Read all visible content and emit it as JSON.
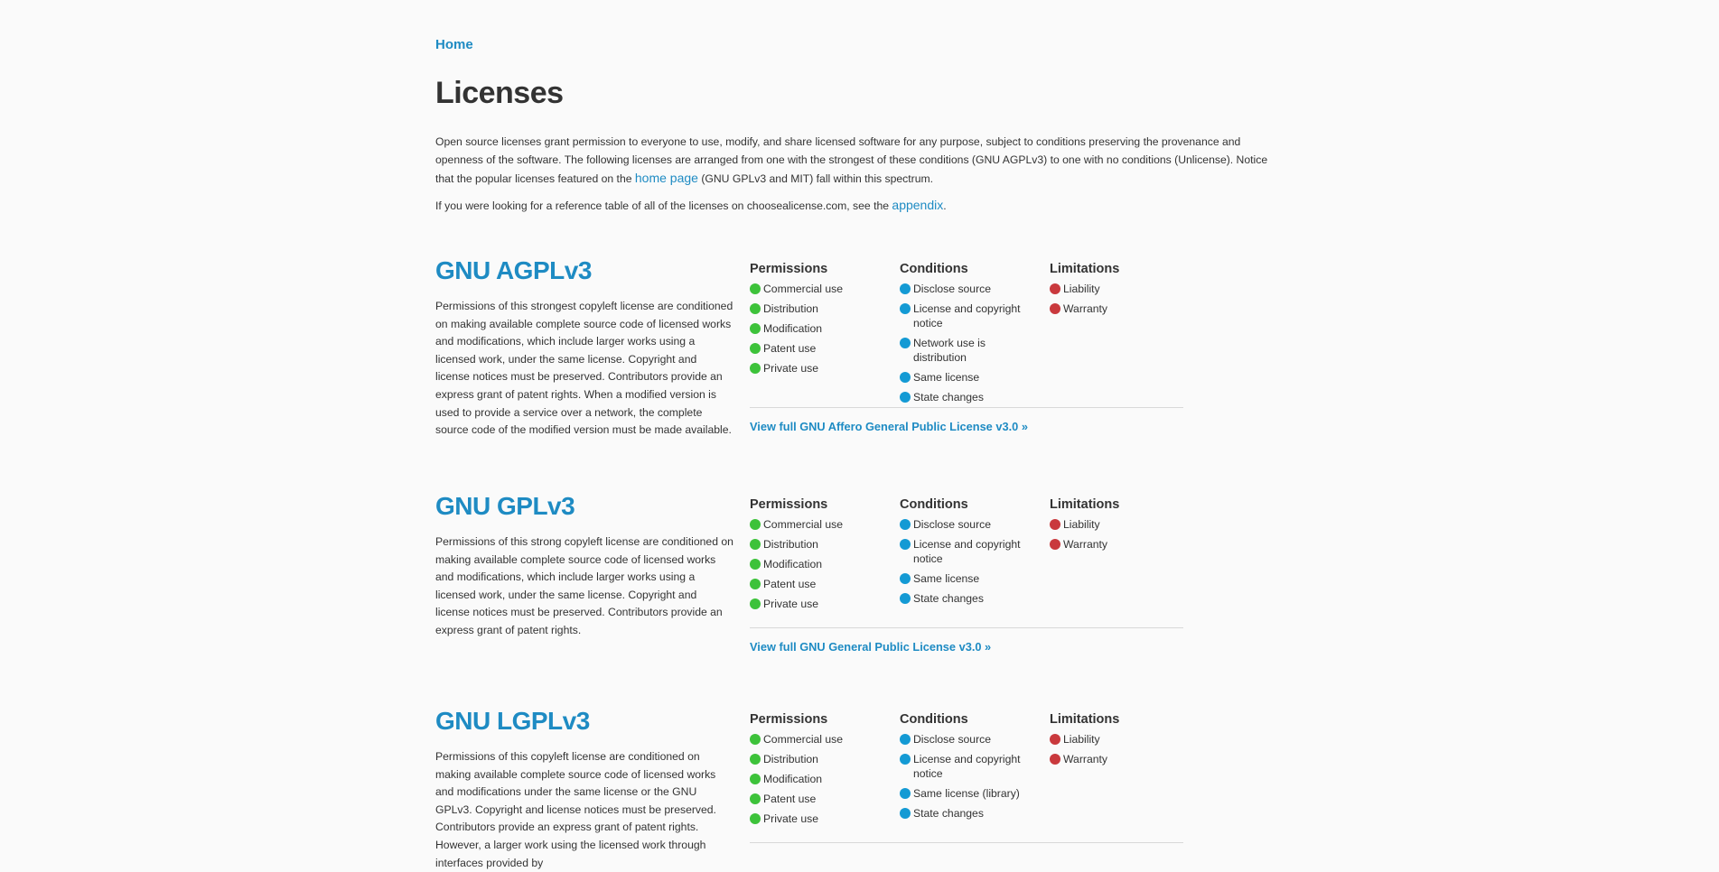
{
  "colors": {
    "accent": "#1e8bc3",
    "permission": "#3dc23a",
    "condition": "#149ad4",
    "limitation": "#c9393d"
  },
  "breadcrumb": {
    "home": "Home"
  },
  "title": "Licenses",
  "intro": {
    "text_1": "Open source licenses grant permission to everyone to use, modify, and share licensed software for any purpose, subject to conditions preserving the provenance and openness of the software. The following licenses are arranged from one with the strongest of these conditions (GNU AGPLv3) to one with no conditions (Unlicense). Notice that the popular licenses featured on the ",
    "link": "home page",
    "text_2": " (GNU GPLv3 and MIT) fall within this spectrum."
  },
  "reference": {
    "text": "If you were looking for a reference table of all of the licenses on choosealicense.com, see the ",
    "link": "appendix",
    "end": "."
  },
  "column_titles": {
    "permissions": "Permissions",
    "conditions": "Conditions",
    "limitations": "Limitations"
  },
  "licenses": [
    {
      "name": "GNU AGPLv3",
      "description": "Permissions of this strongest copyleft license are conditioned on making available complete source code of licensed works and modifications, which include larger works using a licensed work, under the same license. Copyright and license notices must be preserved. Contributors provide an express grant of patent rights. When a modified version is used to provide a service over a network, the complete source code of the modified version must be made available.",
      "permissions": [
        "Commercial use",
        "Distribution",
        "Modification",
        "Patent use",
        "Private use"
      ],
      "conditions": [
        "Disclose source",
        "License and copyright notice",
        "Network use is distribution",
        "Same license",
        "State changes"
      ],
      "limitations": [
        "Liability",
        "Warranty"
      ],
      "full_link": "View full GNU Affero General Public License v3.0 »"
    },
    {
      "name": "GNU GPLv3",
      "description": "Permissions of this strong copyleft license are conditioned on making available complete source code of licensed works and modifications, which include larger works using a licensed work, under the same license. Copyright and license notices must be preserved. Contributors provide an express grant of patent rights.",
      "permissions": [
        "Commercial use",
        "Distribution",
        "Modification",
        "Patent use",
        "Private use"
      ],
      "conditions": [
        "Disclose source",
        "License and copyright notice",
        "Same license",
        "State changes"
      ],
      "limitations": [
        "Liability",
        "Warranty"
      ],
      "full_link": "View full GNU General Public License v3.0 »"
    },
    {
      "name": "GNU LGPLv3",
      "description": "Permissions of this copyleft license are conditioned on making available complete source code of licensed works and modifications under the same license or the GNU GPLv3. Copyright and license notices must be preserved. Contributors provide an express grant of patent rights. However, a larger work using the licensed work through interfaces provided by",
      "permissions": [
        "Commercial use",
        "Distribution",
        "Modification",
        "Patent use",
        "Private use"
      ],
      "conditions": [
        "Disclose source",
        "License and copyright notice",
        "Same license (library)",
        "State changes"
      ],
      "limitations": [
        "Liability",
        "Warranty"
      ],
      "full_link": ""
    }
  ]
}
